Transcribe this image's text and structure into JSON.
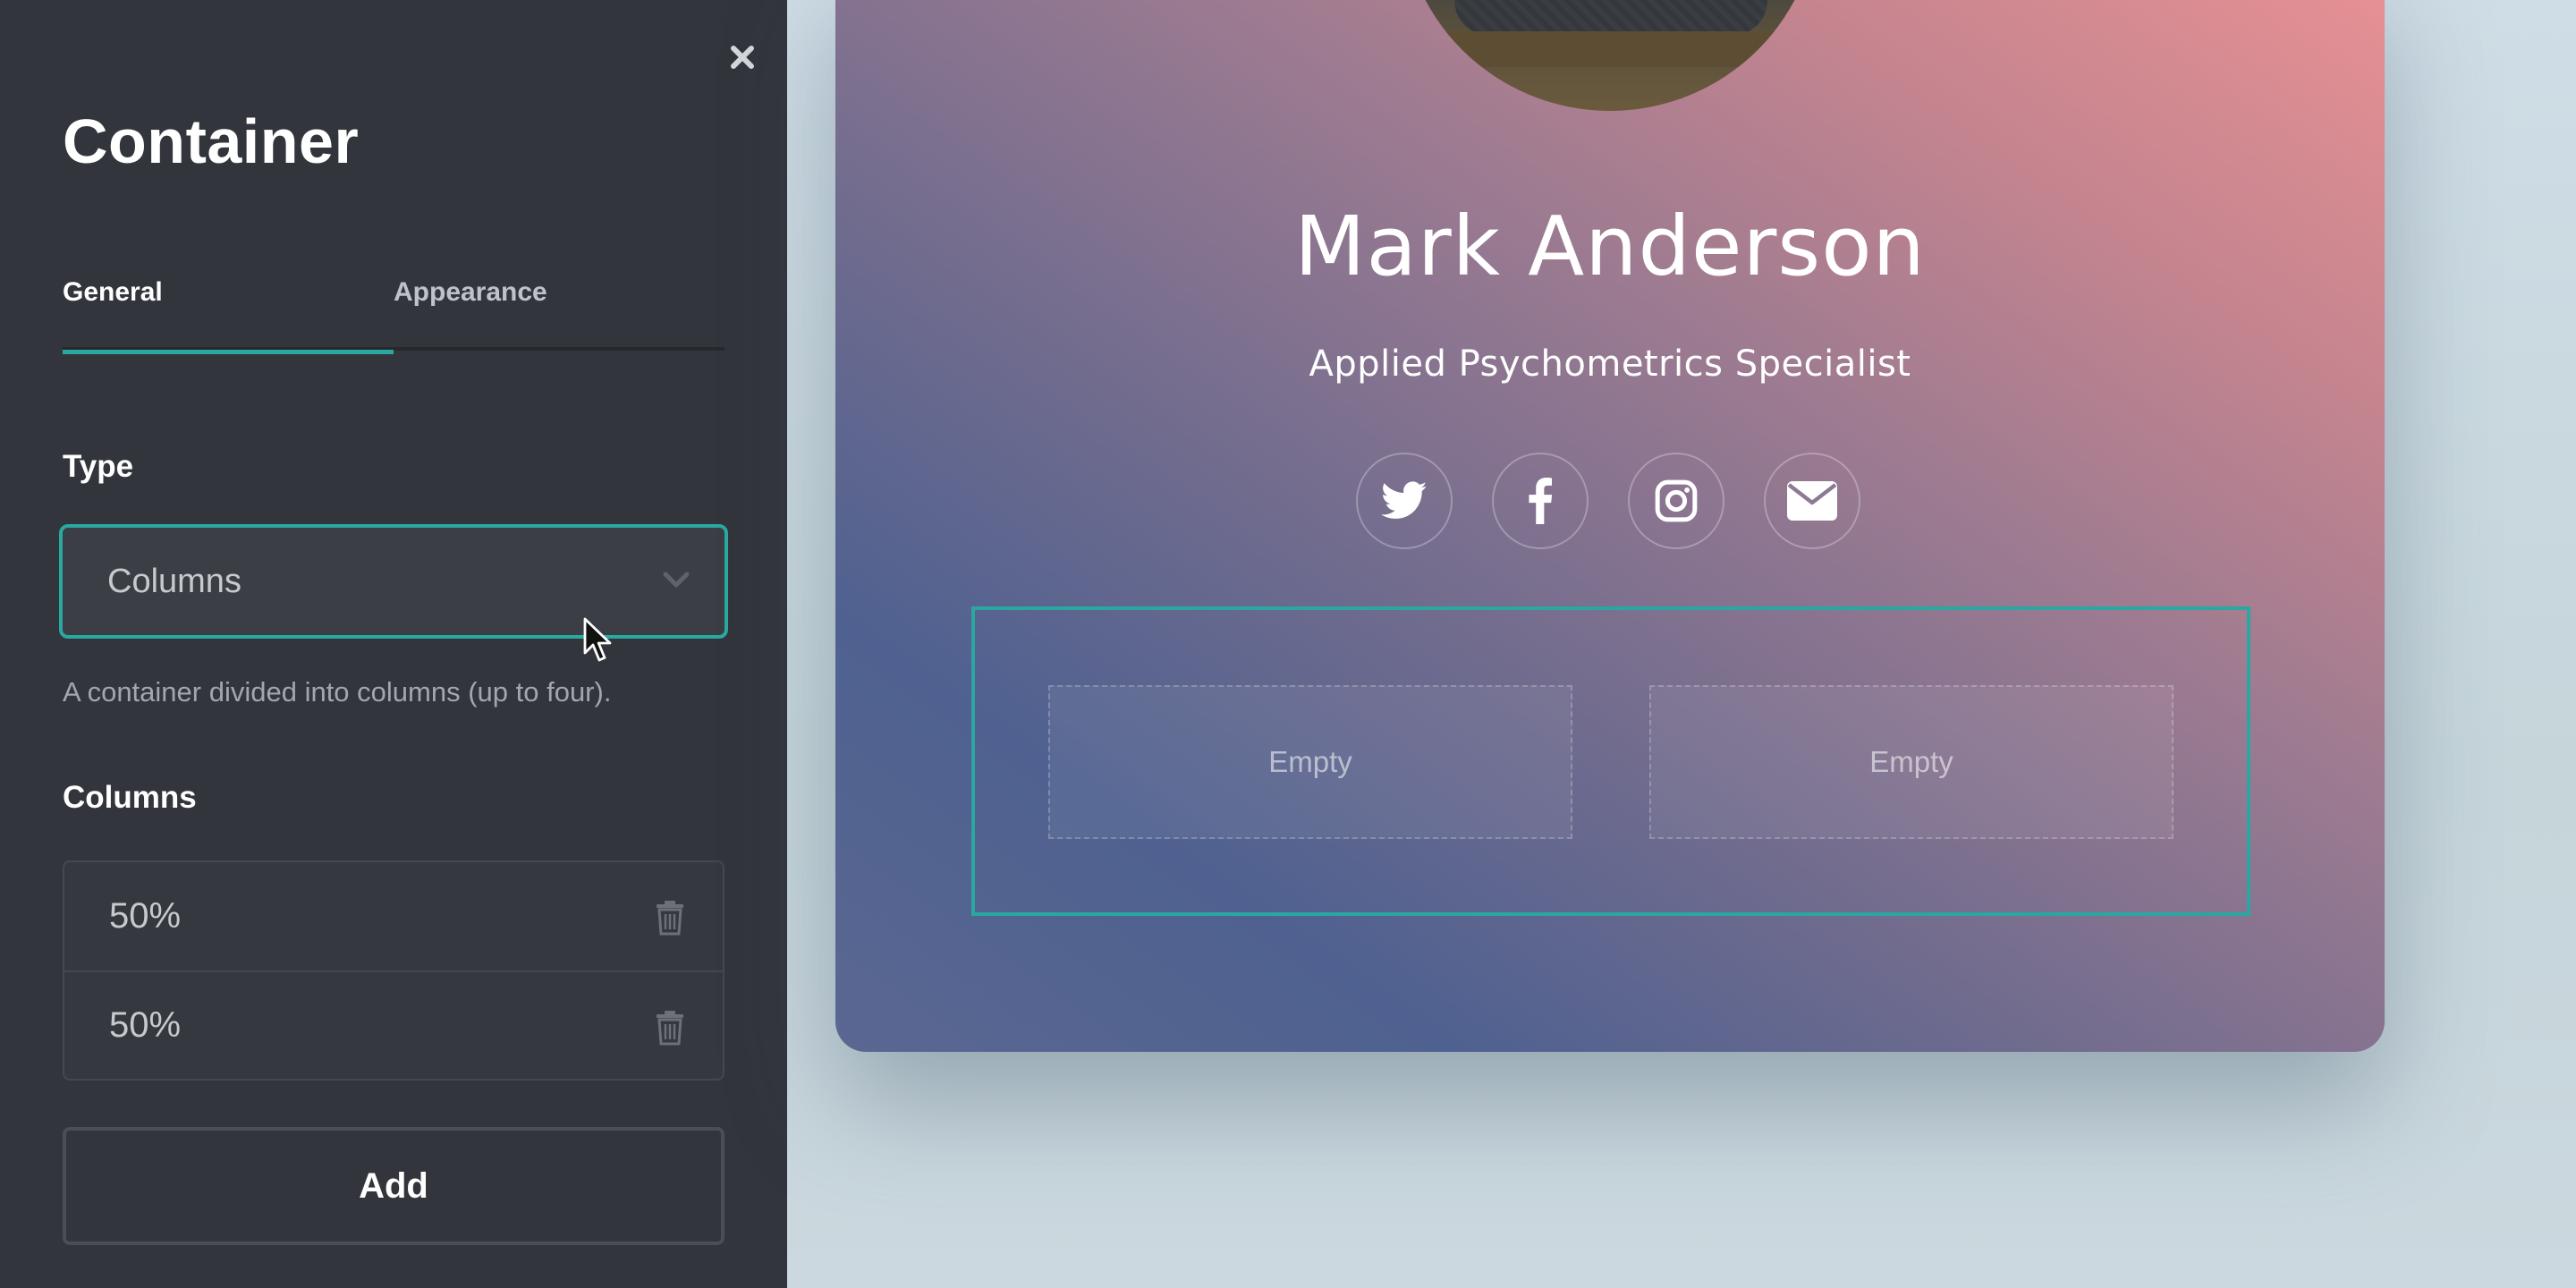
{
  "panel": {
    "title": "Container",
    "close_icon": "close-icon",
    "tabs": [
      {
        "label": "General",
        "active": true
      },
      {
        "label": "Appearance",
        "active": false
      }
    ],
    "type_label": "Type",
    "type_value": "Columns",
    "type_help": "A container divided into columns (up to four).",
    "columns_label": "Columns",
    "columns": [
      {
        "value": "50%"
      },
      {
        "value": "50%"
      }
    ],
    "add_label": "Add"
  },
  "profile": {
    "name": "Mark Anderson",
    "title": "Applied Psychometrics Specialist",
    "socials": [
      "twitter-icon",
      "facebook-icon",
      "instagram-icon",
      "email-icon"
    ],
    "columns_preview": [
      {
        "label": "Empty"
      },
      {
        "label": "Empty"
      }
    ]
  },
  "colors": {
    "panel_bg": "#32353c",
    "accent": "#2ba6a1",
    "card_gradient_start": "#e89194",
    "card_gradient_end": "#4f6190"
  }
}
